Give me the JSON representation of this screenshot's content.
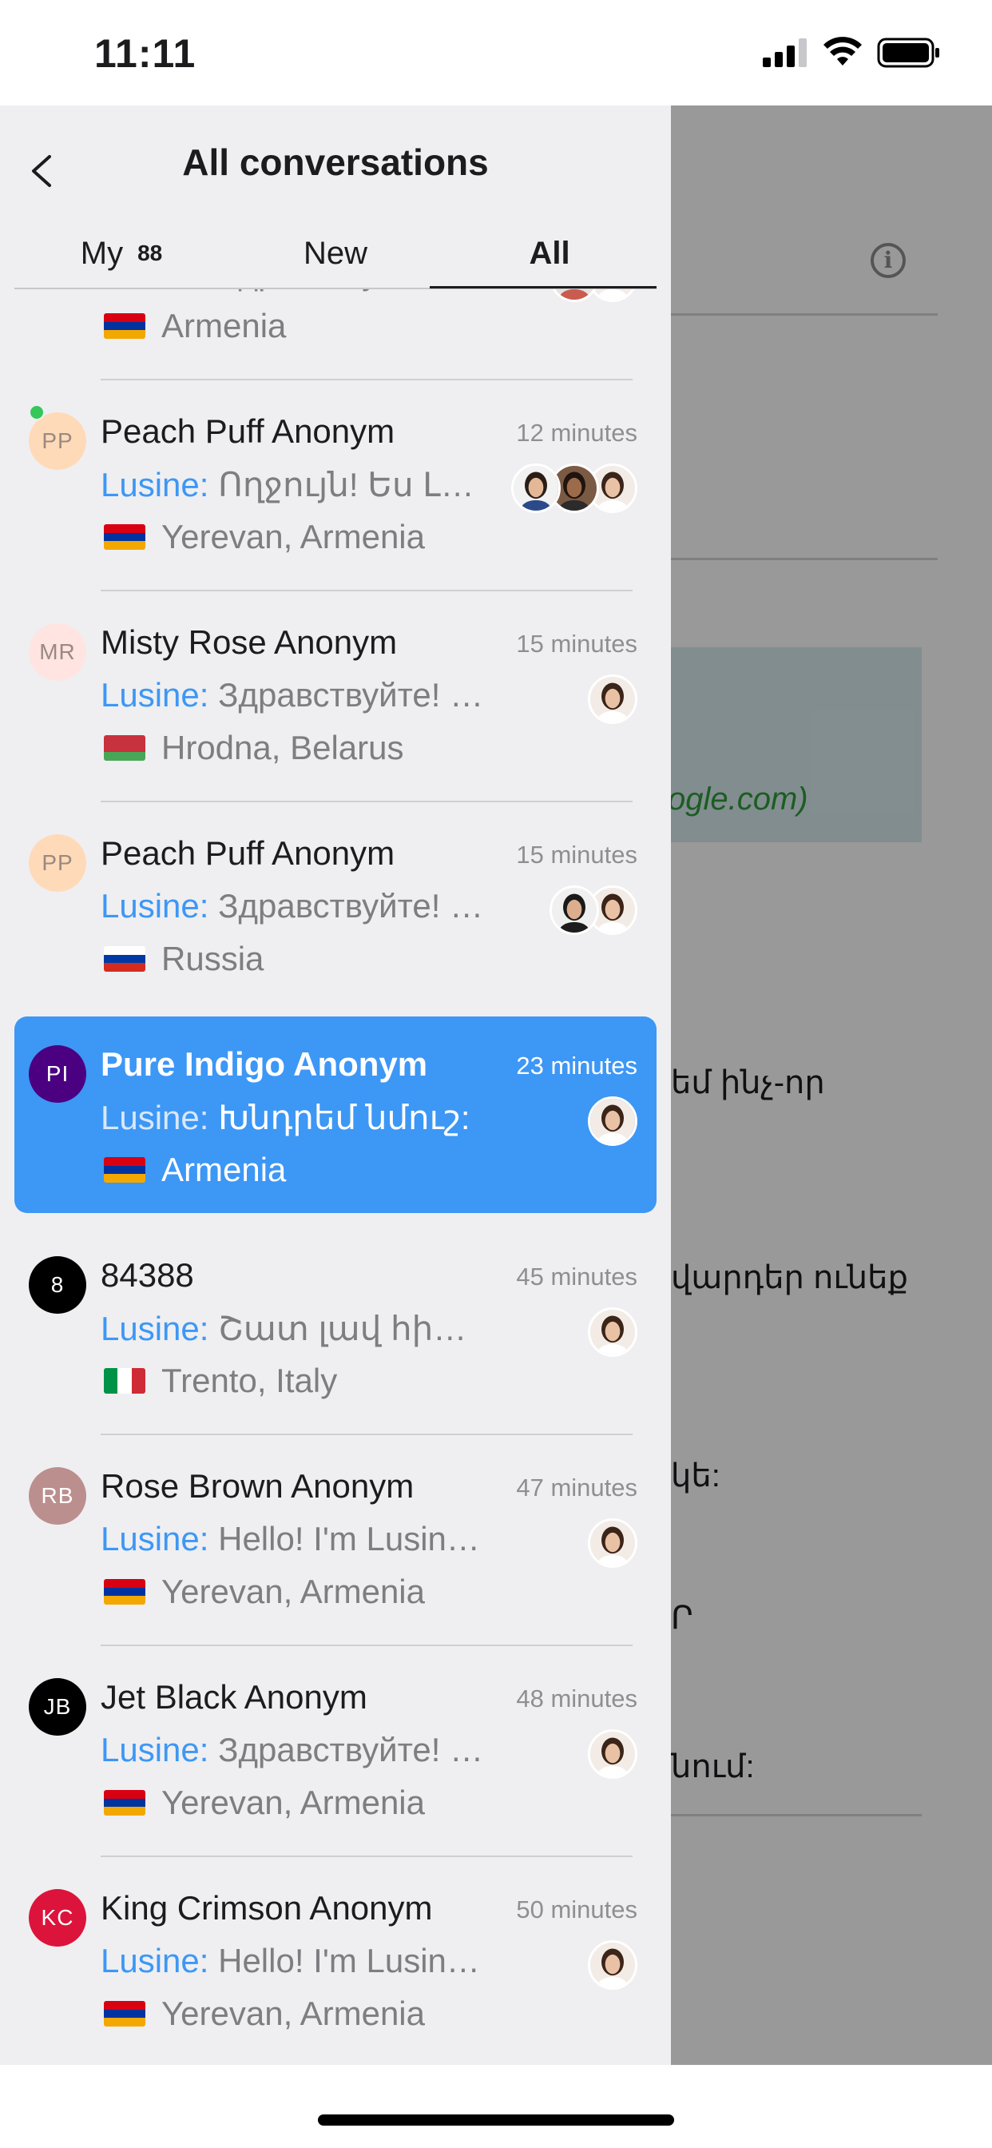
{
  "status_bar": {
    "time": "11:11"
  },
  "drawer": {
    "title": "All conversations",
    "tabs": [
      {
        "label": "My",
        "badge": "88"
      },
      {
        "label": "New",
        "badge": ""
      },
      {
        "label": "All",
        "badge": ""
      }
    ],
    "active_tab": "All"
  },
  "background_app": {
    "snippets": [
      "ogle.com)",
      "եմ ինչ-որ",
      "վարդեր ունեք",
      "կե:",
      "Ր",
      "նում:"
    ]
  },
  "conversations": [
    {
      "initials": "",
      "avatar_color": "",
      "name": "",
      "time": "",
      "sender": "Lusine:",
      "message": "Здравствуйте! Я ...",
      "location": "Armenia",
      "flag": "armenia",
      "agents": [
        "agent-woman-smiling-icon",
        "agent-woman-icon"
      ],
      "online": false,
      "selected": false
    },
    {
      "initials": "PP",
      "avatar_color": "#ffdab9",
      "name": "Peach Puff Anonym",
      "time": "12 minutes",
      "sender": "Lusine:",
      "message": "Ողջույն! Ես Լու...",
      "location": "Yerevan, Armenia",
      "flag": "armenia",
      "agents": [
        "agent-man-icon",
        "agent-woman-dark-icon",
        "agent-woman-icon"
      ],
      "online": true,
      "selected": false
    },
    {
      "initials": "MR",
      "avatar_color": "#ffe4e1",
      "name": "Misty Rose Anonym",
      "time": "15 minutes",
      "sender": "Lusine:",
      "message": "Здравствуйте! Я Лу...",
      "location": "Hrodna, Belarus",
      "flag": "belarus",
      "agents": [
        "agent-woman-icon"
      ],
      "online": false,
      "selected": false
    },
    {
      "initials": "PP",
      "avatar_color": "#ffdab9",
      "name": "Peach Puff Anonym",
      "time": "15 minutes",
      "sender": "Lusine:",
      "message": "Здравствуйте! Я ...",
      "location": "Russia",
      "flag": "russia",
      "agents": [
        "agent-man-headset-icon",
        "agent-woman-icon"
      ],
      "online": false,
      "selected": false
    },
    {
      "initials": "PI",
      "avatar_color": "#4b0082",
      "name": "Pure Indigo Anonym",
      "time": "23 minutes",
      "sender": "Lusine:",
      "message": "Խնդրեմ նմուշ:",
      "location": "Armenia",
      "flag": "armenia",
      "agents": [
        "agent-woman-icon"
      ],
      "online": false,
      "selected": true
    },
    {
      "initials": "8",
      "avatar_color": "#000000",
      "name": "84388",
      "time": "45 minutes",
      "sender": "Lusine:",
      "message": "Շատ լավ հիմա կա...",
      "location": "Trento, Italy",
      "flag": "italy",
      "agents": [
        "agent-woman-icon"
      ],
      "online": false,
      "selected": false
    },
    {
      "initials": "RB",
      "avatar_color": "#bc8f8f",
      "name": "Rose Brown Anonym",
      "time": "47 minutes",
      "sender": "Lusine:",
      "message": "Hello! I'm Lusine, ca...",
      "location": "Yerevan, Armenia",
      "flag": "armenia",
      "agents": [
        "agent-woman-icon"
      ],
      "online": false,
      "selected": false
    },
    {
      "initials": "JB",
      "avatar_color": "#000000",
      "name": "Jet Black Anonym",
      "time": "48 minutes",
      "sender": "Lusine:",
      "message": "Здравствуйте! Я Лу...",
      "location": "Yerevan, Armenia",
      "flag": "armenia",
      "agents": [
        "agent-woman-icon"
      ],
      "online": false,
      "selected": false
    },
    {
      "initials": "KC",
      "avatar_color": "#dc143c",
      "name": "King Crimson Anonym",
      "time": "50 minutes",
      "sender": "Lusine:",
      "message": "Hello! I'm Lusine, ca...",
      "location": "Yerevan, Armenia",
      "flag": "armenia",
      "agents": [
        "agent-woman-icon"
      ],
      "online": false,
      "selected": false
    }
  ]
}
